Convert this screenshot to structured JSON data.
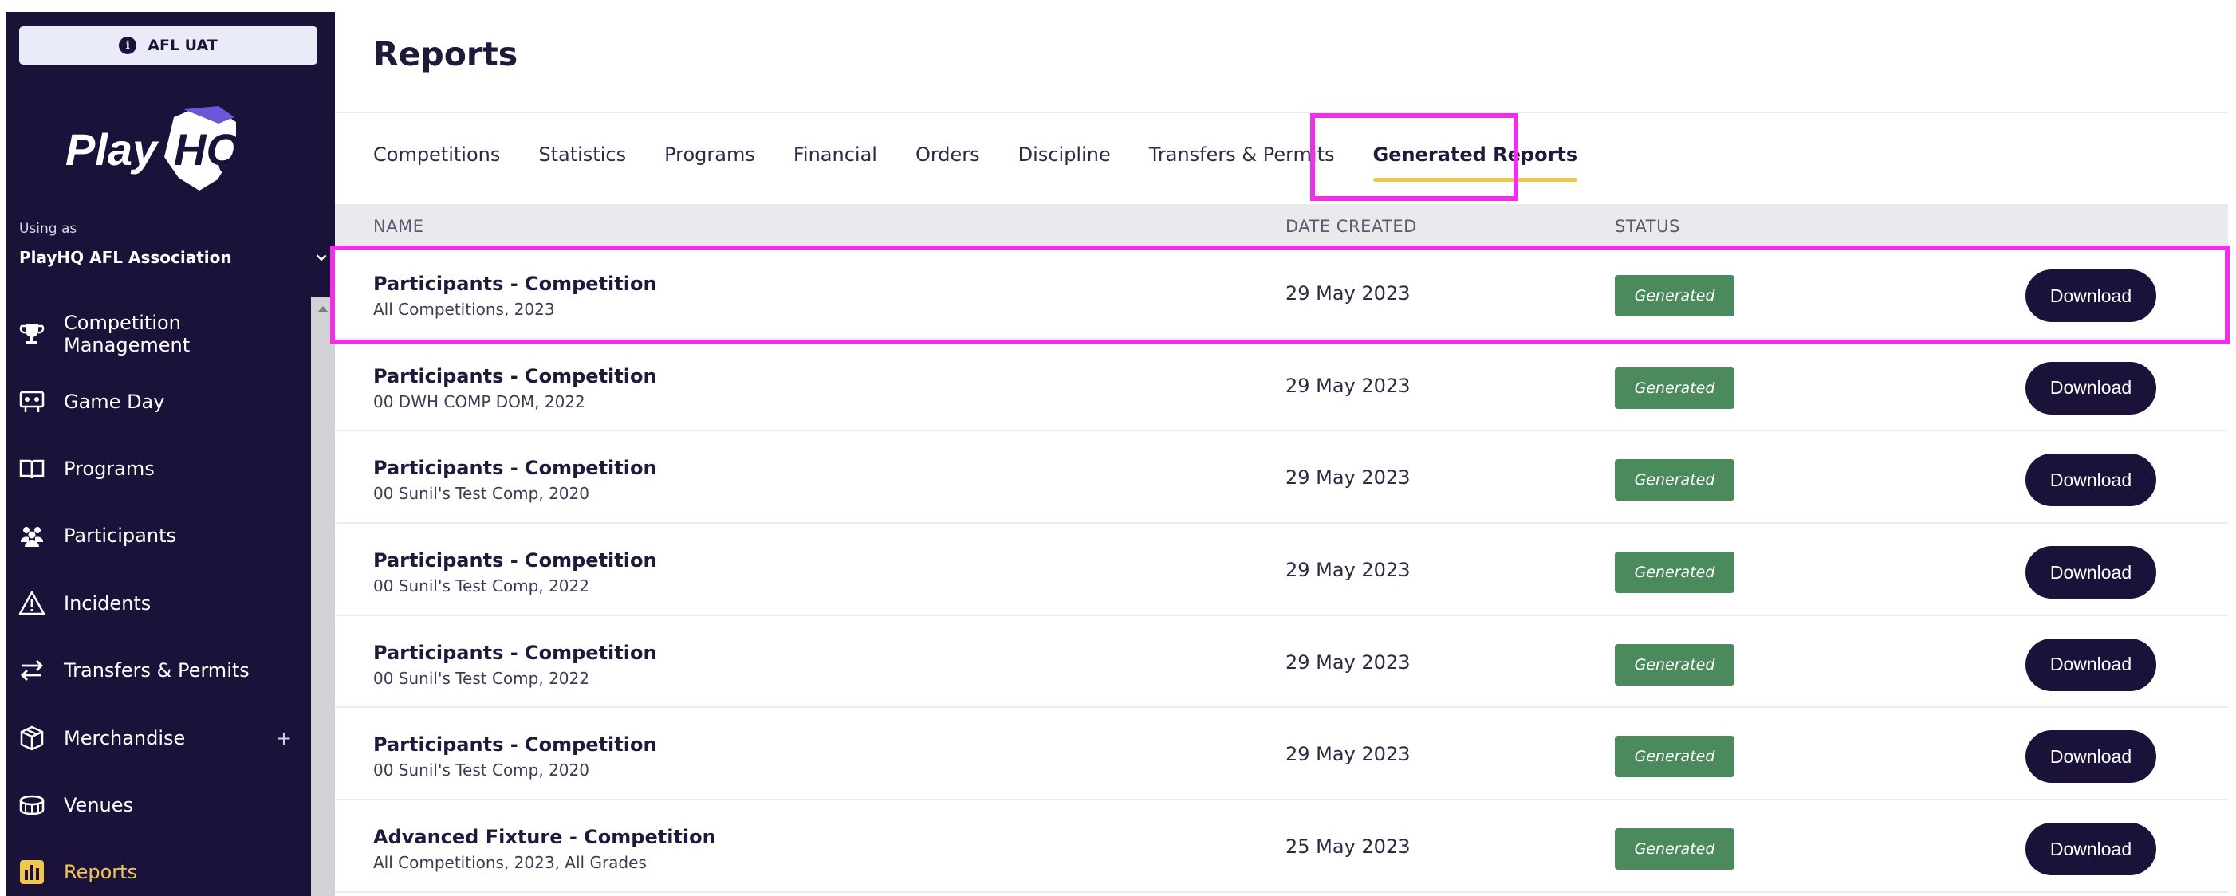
{
  "env_badge": {
    "label": "AFL UAT",
    "icon": "info-icon"
  },
  "logo": {
    "text": "Play HQ",
    "brand_color": "#1a1238",
    "accent": "#6b57d9"
  },
  "account": {
    "using_as_label": "Using as",
    "org_name": "PlayHQ AFL Association"
  },
  "nav": [
    {
      "label": "Competition Management",
      "icon": "trophy-icon"
    },
    {
      "label": "Game Day",
      "icon": "scoreboard-icon"
    },
    {
      "label": "Programs",
      "icon": "book-icon"
    },
    {
      "label": "Participants",
      "icon": "people-icon"
    },
    {
      "label": "Incidents",
      "icon": "warning-icon"
    },
    {
      "label": "Transfers & Permits",
      "icon": "transfer-icon"
    },
    {
      "label": "Merchandise",
      "icon": "box-icon",
      "expand": "+"
    },
    {
      "label": "Venues",
      "icon": "stadium-icon"
    },
    {
      "label": "Reports",
      "icon": "reports-icon",
      "active": true
    }
  ],
  "page": {
    "title": "Reports"
  },
  "tabs": [
    {
      "label": "Competitions"
    },
    {
      "label": "Statistics"
    },
    {
      "label": "Programs"
    },
    {
      "label": "Financial"
    },
    {
      "label": "Orders"
    },
    {
      "label": "Discipline"
    },
    {
      "label": "Transfers & Permits"
    },
    {
      "label": "Generated Reports",
      "active": true
    }
  ],
  "table": {
    "columns": {
      "name": "NAME",
      "date": "DATE CREATED",
      "status": "STATUS"
    },
    "rows": [
      {
        "name": "Participants - Competition",
        "sub": "All Competitions, 2023",
        "date": "29 May 2023",
        "status": "Generated",
        "action": "Download"
      },
      {
        "name": "Participants - Competition",
        "sub": "00 DWH COMP DOM, 2022",
        "date": "29 May 2023",
        "status": "Generated",
        "action": "Download"
      },
      {
        "name": "Participants - Competition",
        "sub": "00 Sunil's Test Comp, 2020",
        "date": "29 May 2023",
        "status": "Generated",
        "action": "Download"
      },
      {
        "name": "Participants - Competition",
        "sub": "00 Sunil's Test Comp, 2022",
        "date": "29 May 2023",
        "status": "Generated",
        "action": "Download"
      },
      {
        "name": "Participants - Competition",
        "sub": "00 Sunil's Test Comp, 2022",
        "date": "29 May 2023",
        "status": "Generated",
        "action": "Download"
      },
      {
        "name": "Participants - Competition",
        "sub": "00 Sunil's Test Comp, 2020",
        "date": "29 May 2023",
        "status": "Generated",
        "action": "Download"
      },
      {
        "name": "Advanced Fixture - Competition",
        "sub": "All Competitions, 2023, All Grades",
        "date": "25 May 2023",
        "status": "Generated",
        "action": "Download"
      }
    ]
  },
  "colors": {
    "sidebar_bg": "#1a1238",
    "active_nav": "#f3c64a",
    "status_generated": "#4a8a5c",
    "highlight": "#ee30e6"
  }
}
